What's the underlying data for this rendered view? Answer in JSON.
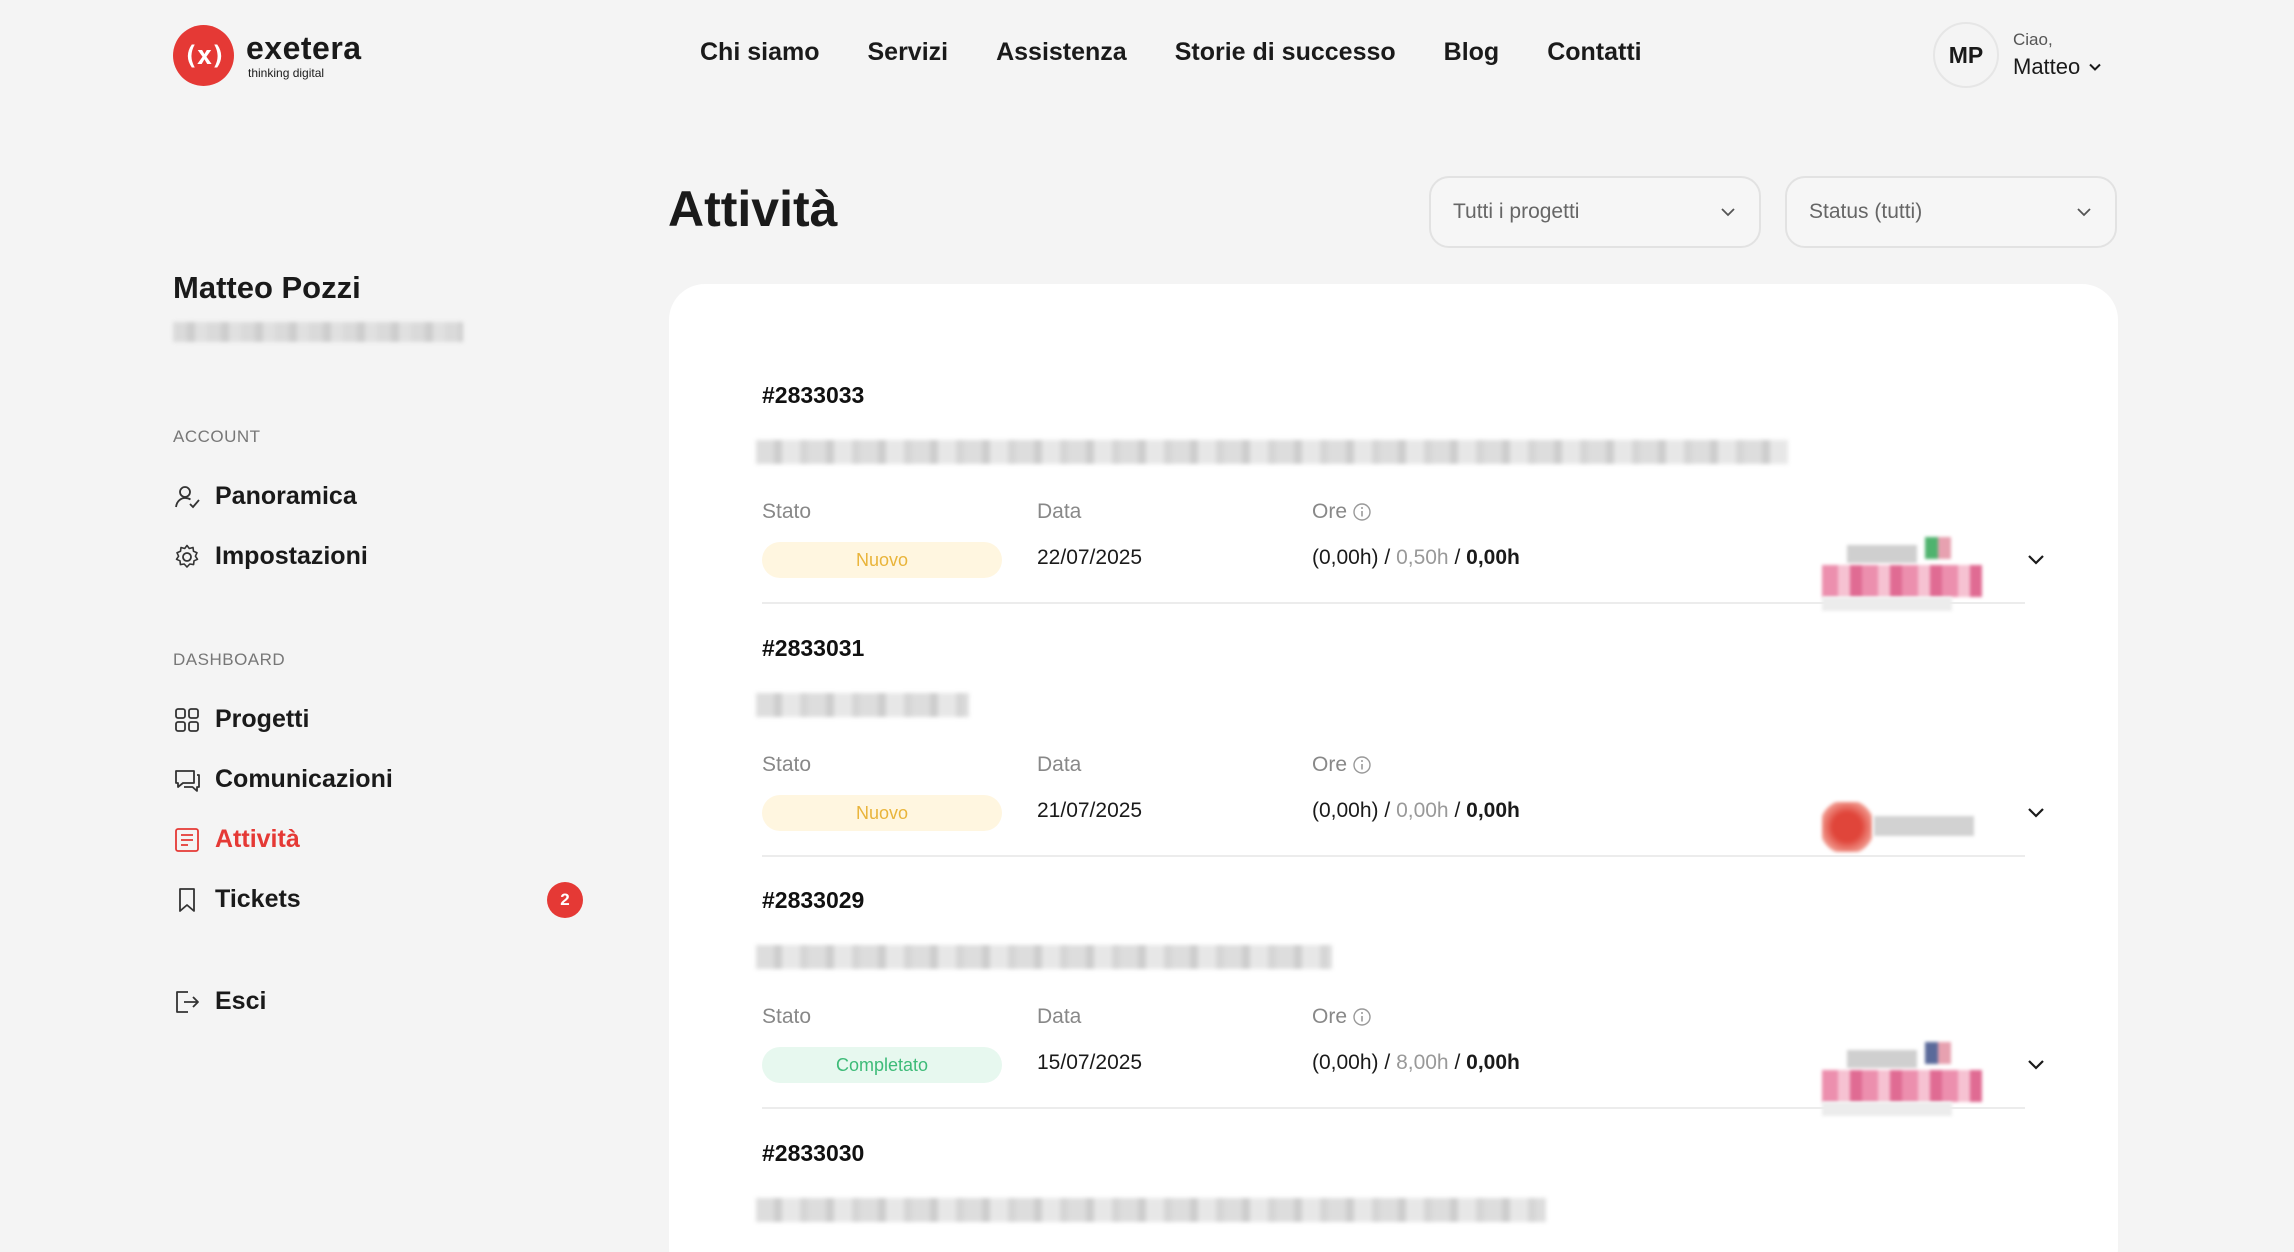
{
  "brand": {
    "logo_mark": "(x)",
    "name": "exetera",
    "tagline": "thinking digital",
    "accent_color": "#e53935"
  },
  "nav": {
    "items": [
      "Chi siamo",
      "Servizi",
      "Assistenza",
      "Storie di successo",
      "Blog",
      "Contatti"
    ]
  },
  "user": {
    "initials": "MP",
    "greeting": "Ciao,",
    "first_name": "Matteo",
    "menu_icon": "chevron-down-icon"
  },
  "sidebar": {
    "profile_name": "Matteo Pozzi",
    "account_label": "ACCOUNT",
    "account_items": [
      {
        "label": "Panoramica",
        "icon": "user-icon"
      },
      {
        "label": "Impostazioni",
        "icon": "gear-icon"
      }
    ],
    "dashboard_label": "DASHBOARD",
    "dashboard_items": [
      {
        "label": "Progetti",
        "icon": "grid-icon"
      },
      {
        "label": "Comunicazioni",
        "icon": "chat-icon"
      },
      {
        "label": "Attività",
        "icon": "document-icon",
        "active": true
      },
      {
        "label": "Tickets",
        "icon": "bookmark-icon",
        "badge": "2"
      }
    ],
    "logout_label": "Esci",
    "logout_icon": "logout-icon"
  },
  "main": {
    "title": "Attività",
    "filters": {
      "projects": "Tutti i progetti",
      "status": "Status (tutti)"
    },
    "labels": {
      "stato": "Stato",
      "data": "Data",
      "ore": "Ore"
    },
    "activities": [
      {
        "id": "#2833033",
        "status": "Nuovo",
        "status_kind": "new",
        "date": "22/07/2025",
        "ore_logged": "(0,00h)",
        "ore_estimated": "0,50h",
        "ore_total": "0,00h"
      },
      {
        "id": "#2833031",
        "status": "Nuovo",
        "status_kind": "new",
        "date": "21/07/2025",
        "ore_logged": "(0,00h)",
        "ore_estimated": "0,00h",
        "ore_total": "0,00h"
      },
      {
        "id": "#2833029",
        "status": "Completato",
        "status_kind": "done",
        "date": "15/07/2025",
        "ore_logged": "(0,00h)",
        "ore_estimated": "8,00h",
        "ore_total": "0,00h"
      },
      {
        "id": "#2833030"
      }
    ]
  }
}
